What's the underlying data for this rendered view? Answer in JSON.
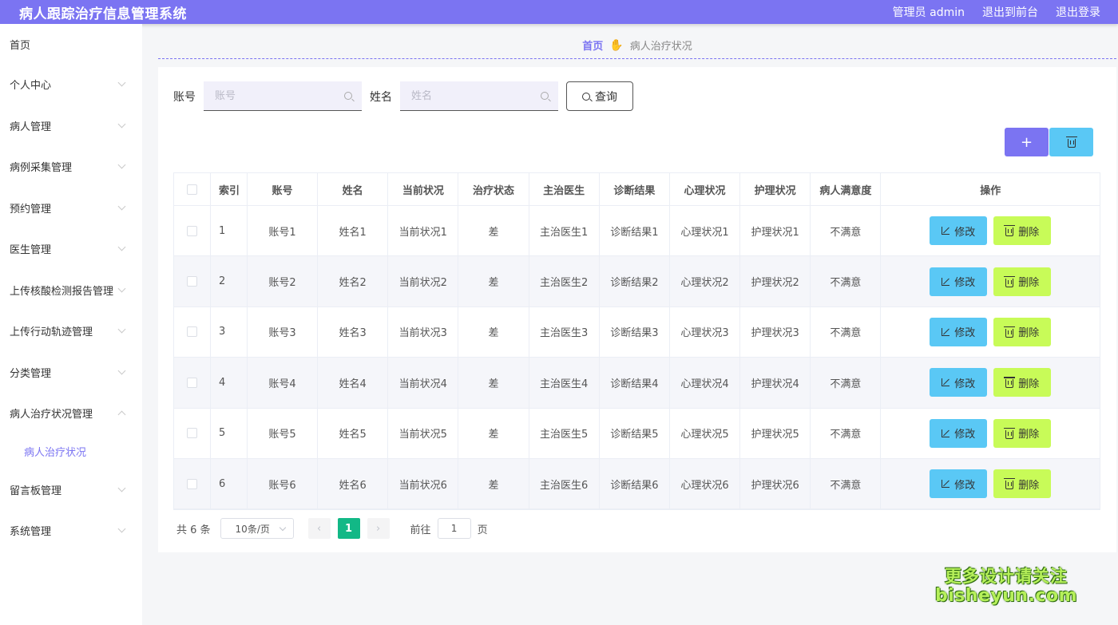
{
  "header": {
    "title": "病人跟踪治疗信息管理系统",
    "user": "管理员 admin",
    "to_front": "退出到前台",
    "logout": "退出登录"
  },
  "sidebar": {
    "items": [
      {
        "label": "首页",
        "expandable": false
      },
      {
        "label": "个人中心",
        "expandable": true
      },
      {
        "label": "病人管理",
        "expandable": true
      },
      {
        "label": "病例采集管理",
        "expandable": true
      },
      {
        "label": "预约管理",
        "expandable": true
      },
      {
        "label": "医生管理",
        "expandable": true
      },
      {
        "label": "上传核酸检测报告管理",
        "expandable": true
      },
      {
        "label": "上传行动轨迹管理",
        "expandable": true
      },
      {
        "label": "分类管理",
        "expandable": true
      },
      {
        "label": "病人治疗状况管理",
        "expandable": true,
        "expanded": true
      },
      {
        "label": "留言板管理",
        "expandable": true
      },
      {
        "label": "系统管理",
        "expandable": true
      }
    ],
    "active_sub": "病人治疗状况"
  },
  "breadcrumb": {
    "home": "首页",
    "current": "病人治疗状况"
  },
  "search": {
    "account_label": "账号",
    "account_placeholder": "账号",
    "name_label": "姓名",
    "name_placeholder": "姓名",
    "query_label": "查询"
  },
  "toolbar": {
    "add_label": "+"
  },
  "table": {
    "headers": [
      "索引",
      "账号",
      "姓名",
      "当前状况",
      "治疗状态",
      "主治医生",
      "诊断结果",
      "心理状况",
      "护理状况",
      "病人满意度",
      "操作"
    ],
    "edit_label": "修改",
    "delete_label": "删除",
    "rows": [
      [
        "1",
        "账号1",
        "姓名1",
        "当前状况1",
        "差",
        "主治医生1",
        "诊断结果1",
        "心理状况1",
        "护理状况1",
        "不满意"
      ],
      [
        "2",
        "账号2",
        "姓名2",
        "当前状况2",
        "差",
        "主治医生2",
        "诊断结果2",
        "心理状况2",
        "护理状况2",
        "不满意"
      ],
      [
        "3",
        "账号3",
        "姓名3",
        "当前状况3",
        "差",
        "主治医生3",
        "诊断结果3",
        "心理状况3",
        "护理状况3",
        "不满意"
      ],
      [
        "4",
        "账号4",
        "姓名4",
        "当前状况4",
        "差",
        "主治医生4",
        "诊断结果4",
        "心理状况4",
        "护理状况4",
        "不满意"
      ],
      [
        "5",
        "账号5",
        "姓名5",
        "当前状况5",
        "差",
        "主治医生5",
        "诊断结果5",
        "心理状况5",
        "护理状况5",
        "不满意"
      ],
      [
        "6",
        "账号6",
        "姓名6",
        "当前状况6",
        "差",
        "主治医生6",
        "诊断结果6",
        "心理状况6",
        "护理状况6",
        "不满意"
      ]
    ]
  },
  "pagination": {
    "total": "共 6 条",
    "page_size": "10条/页",
    "prev": "‹",
    "next": "›",
    "current_page": "1",
    "goto_prefix": "前往",
    "goto_value": "1",
    "goto_suffix": "页"
  },
  "watermark": {
    "line1": "更多设计请关注",
    "line2": "bisheyun.com"
  },
  "colors": {
    "accent": "#7b74f2",
    "edit": "#5ac8f5",
    "delete": "#c8fb58",
    "page_active": "#12b886"
  }
}
